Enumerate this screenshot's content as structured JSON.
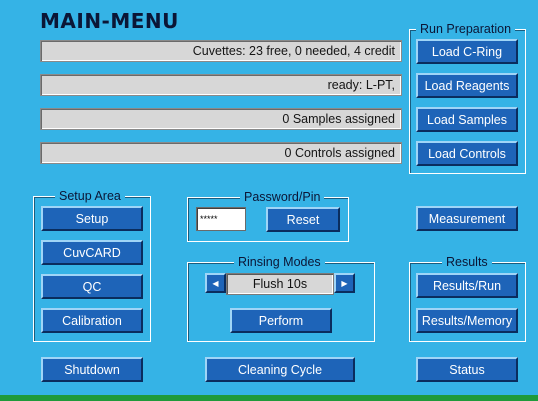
{
  "header": {
    "title": "MAIN-MENU"
  },
  "status_boxes": [
    "Cuvettes: 23  free,  0  needed,  4  credit",
    "ready: L-PT,",
    "0  Samples  assigned",
    "0  Controls  assigned"
  ],
  "run_preparation": {
    "legend": "Run  Preparation",
    "buttons": [
      "Load  C-Ring",
      "Load  Reagents",
      "Load  Samples",
      "Load  Controls"
    ]
  },
  "setup_area": {
    "legend": "Setup  Area",
    "buttons": [
      "Setup",
      "CuvCARD",
      "QC",
      "Calibration"
    ]
  },
  "password": {
    "legend": "Password/Pin",
    "value": "*****",
    "reset_label": "Reset"
  },
  "rinsing": {
    "legend": "Rinsing  Modes",
    "mode": "Flush  10s",
    "left_arrow": "◀",
    "right_arrow": "▶",
    "perform_label": "Perform"
  },
  "measurement_label": "Measurement",
  "results": {
    "legend": "Results",
    "buttons": [
      "Results/Run",
      "Results/Memory"
    ]
  },
  "bottom": {
    "shutdown_label": "Shutdown",
    "cleaning_label": "Cleaning  Cycle",
    "status_label": "Status"
  },
  "colors": {
    "background": "#35b3e6",
    "button": "#1e64b8",
    "footer": "#1f9a3a"
  }
}
